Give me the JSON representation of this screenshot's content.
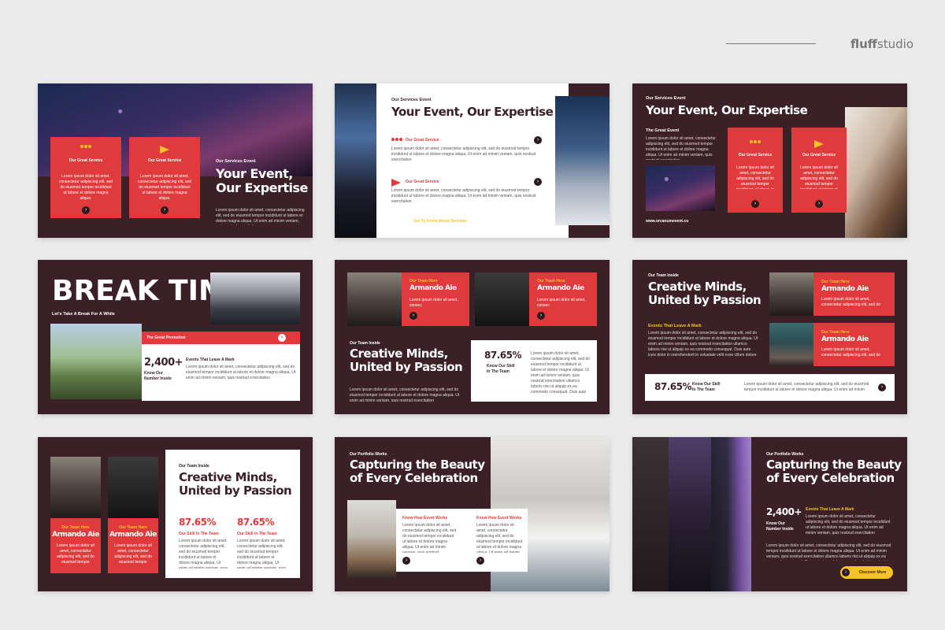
{
  "brand": {
    "prefix": "fluff",
    "suffix": "studio"
  },
  "lorem_short": "Lorem ipsum dolor sit amet, consectetur adipiscing elit, sed do eiusmod tempor incididunt ut labore et dolore magna aliqua. Ut enim ad minim veniam, quis nostrud exercitation",
  "lorem_long": "Lorem ipsum dolor sit amet, consectetur adipiscing elit, sed do eiusmod tempor incididunt ut labore et dolore magna aliqua. Ut enim ad minim veniam, quis nostrud exercitation ullamco laboris nisi ut aliquip ex ea commodo consequat. Duis aute irure dolor in reprehenderit in voluptate velit esse cillum dolore eu fugiat nulla pariatur. Excepteur sint",
  "lorem_card": "Lorem ipsum dolor sit amet, consectetur adipiscing elit, sed do eiusmod tempor incididunt ut labore et dolore magna aliqua.",
  "slide1": {
    "card1_title": "Our Great Service",
    "card2_title": "Our Great Service",
    "kicker": "Our Services Event",
    "title_line1": "Your Event,",
    "title_line2": "Our Expertise"
  },
  "slide2": {
    "kicker": "Our Services Event",
    "title": "Your Event, Our Expertise",
    "item1": "Our Great Service",
    "item2": "Our Great Service",
    "link": "Get To Know About Services"
  },
  "slide3": {
    "kicker": "Our Services Event",
    "title": "Your Event, Our Expertise",
    "subtitle": "The Great Event",
    "card1_title": "Our Great Service",
    "card2_title": "Our Great Service",
    "website": "www.orcanumevent.co"
  },
  "slide4": {
    "title": "BREAK TIME",
    "subtitle": "Let's Take A Break For A While",
    "promo": "The Great Promotion",
    "stat": "2,400+",
    "stat_label1": "Know Our",
    "stat_label2": "Number Inside",
    "events_title": "Events That Leave A Mark"
  },
  "slide5": {
    "team1_kicker": "Our Team Here",
    "team1_name": "Armando Aie",
    "team1_text": "Lorem ipsum dolor sit amet, consec",
    "team2_kicker": "Our Team Here",
    "team2_name": "Armando Aie",
    "team2_text": "Lorem ipsum dolor sit amet, consec",
    "kicker": "Our Team Inside",
    "title_line1": "Creative Minds,",
    "title_line2": "United by Passion",
    "percent": "87.65%",
    "percent_label1": "Know Our Skill",
    "percent_label2": "In The Team"
  },
  "slide6": {
    "kicker": "Our Team Inside",
    "title_line1": "Creative Minds,",
    "title_line2": "United by Passion",
    "events_title": "Events That Leave A Mark",
    "team1_kicker": "Our Team Here",
    "team1_name": "Armando Aie",
    "team2_kicker": "Our Team Here",
    "team2_name": "Armando Aie",
    "percent": "87.65%",
    "percent_label1": "Know Our Skill",
    "percent_label2": "In The Team"
  },
  "slide7": {
    "team1_kicker": "Our Team Here",
    "team1_name": "Armando Aie",
    "team2_kicker": "Our Team Here",
    "team2_name": "Armando Aie",
    "kicker": "Our Team Inside",
    "title_line1": "Creative Minds,",
    "title_line2": "United by Passion",
    "percent1": "87.65%",
    "percent1_label": "Our Skill In The Team",
    "percent2": "87.65%",
    "percent2_label": "Our Skill In The Team"
  },
  "slide8": {
    "kicker": "Our Portfolio Works",
    "title_line1": "Capturing the Beauty",
    "title_line2": "of Every Celebration",
    "col1_title": "Know How Event Works",
    "col2_title": "Know How Event Works"
  },
  "slide9": {
    "kicker": "Our Portfolio Works",
    "title_line1": "Capturing the Beauty",
    "title_line2": "of Every Celebration",
    "stat": "2,400+",
    "stat_label1": "Know Our",
    "stat_label2": "Number Inside",
    "events_title": "Events That Leave A Mark",
    "button": "Discover More"
  },
  "colors": {
    "accent": "#e03a3c",
    "dark": "#3b2127",
    "yellow": "#f7c325",
    "background": "#ebebeb"
  },
  "icons": [
    "people-icon",
    "megaphone-icon",
    "arrow-right-icon"
  ]
}
